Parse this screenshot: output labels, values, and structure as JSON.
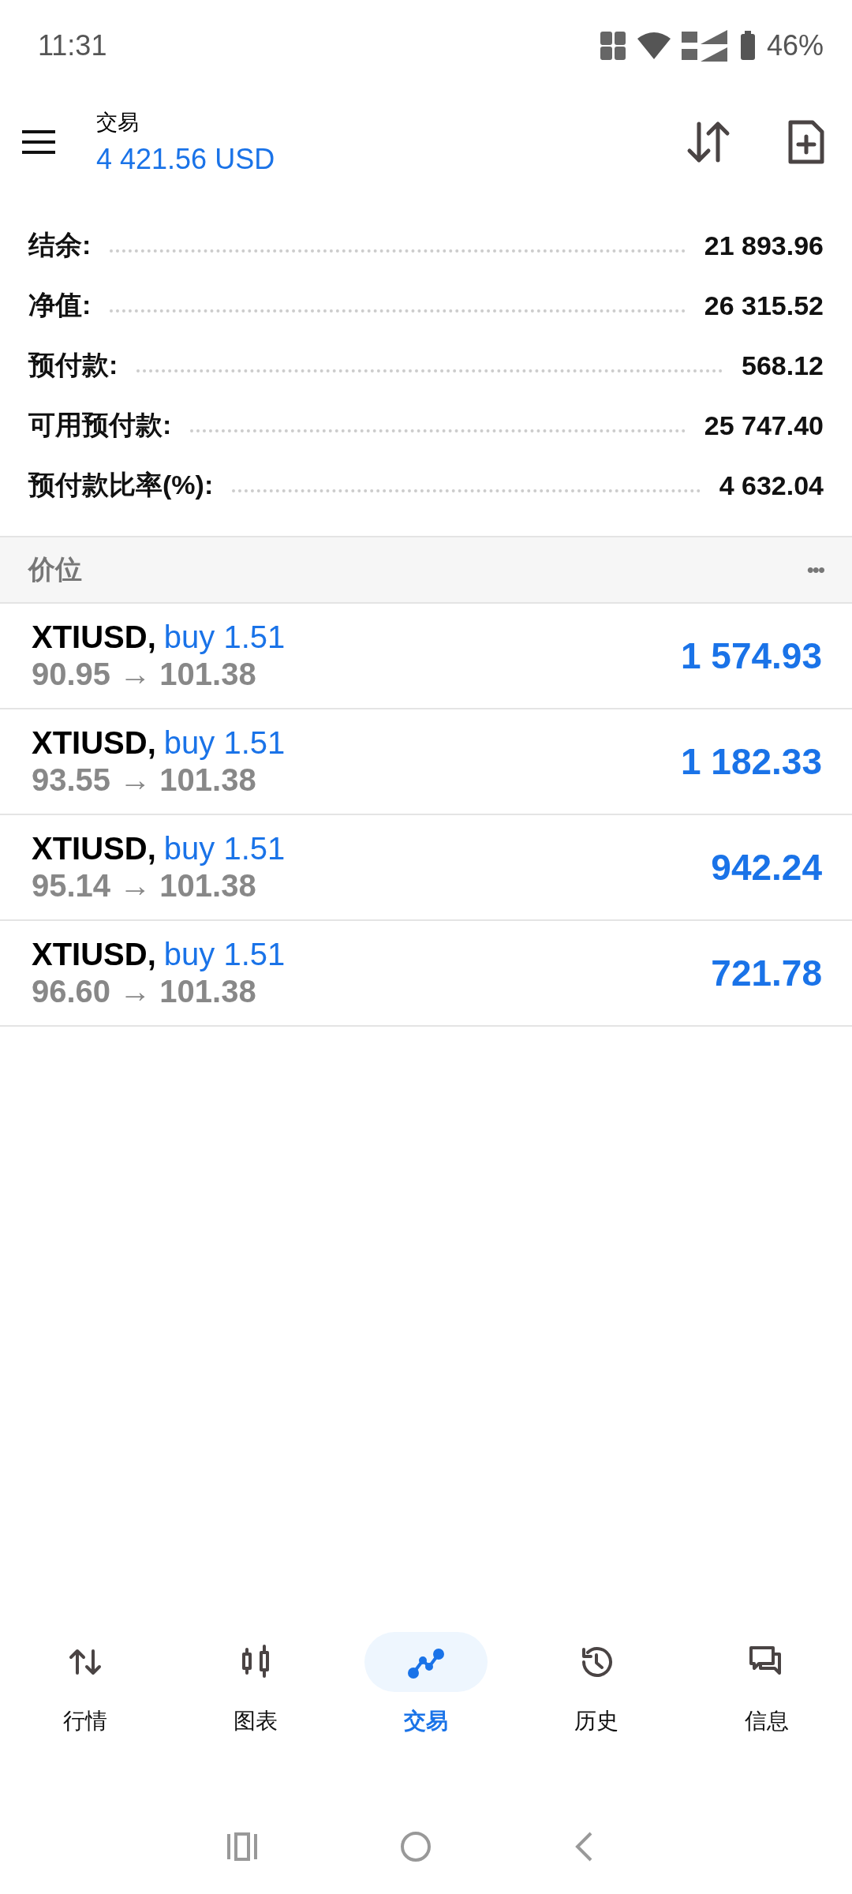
{
  "status_bar": {
    "time": "11:31",
    "battery": "46%"
  },
  "header": {
    "title": "交易",
    "balance": "4 421.56 USD"
  },
  "summary": [
    {
      "label": "结余:",
      "value": "21 893.96"
    },
    {
      "label": "净值:",
      "value": "26 315.52"
    },
    {
      "label": "预付款:",
      "value": "568.12"
    },
    {
      "label": "可用预付款:",
      "value": "25 747.40"
    },
    {
      "label": "预付款比率(%):",
      "value": "4 632.04"
    }
  ],
  "section": {
    "title": "价位",
    "menu": "•••"
  },
  "positions": [
    {
      "symbol": "XTIUSD,",
      "side": "buy 1.51",
      "open": "90.95",
      "arrow": "→",
      "current": "101.38",
      "profit": "1 574.93"
    },
    {
      "symbol": "XTIUSD,",
      "side": "buy 1.51",
      "open": "93.55",
      "arrow": "→",
      "current": "101.38",
      "profit": "1 182.33"
    },
    {
      "symbol": "XTIUSD,",
      "side": "buy 1.51",
      "open": "95.14",
      "arrow": "→",
      "current": "101.38",
      "profit": "942.24"
    },
    {
      "symbol": "XTIUSD,",
      "side": "buy 1.51",
      "open": "96.60",
      "arrow": "→",
      "current": "101.38",
      "profit": "721.78"
    }
  ],
  "bottom_nav": [
    {
      "label": "行情",
      "kind": "quotes",
      "selected": false
    },
    {
      "label": "图表",
      "kind": "chart",
      "selected": false
    },
    {
      "label": "交易",
      "kind": "trade",
      "selected": true
    },
    {
      "label": "历史",
      "kind": "history",
      "selected": false
    },
    {
      "label": "信息",
      "kind": "messages",
      "selected": false
    }
  ]
}
